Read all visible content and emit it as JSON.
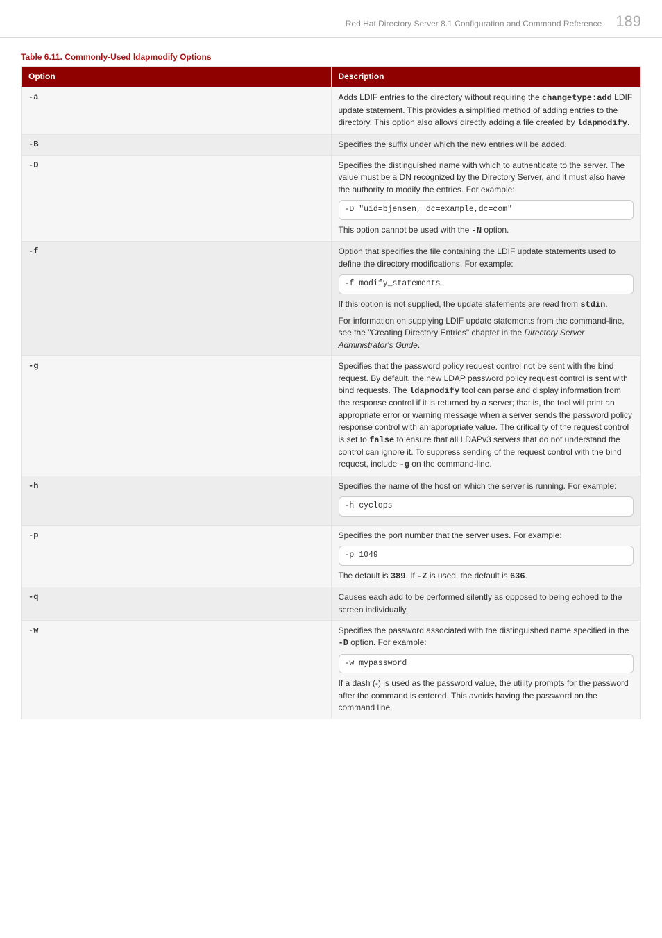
{
  "header": {
    "doc_title": "Red Hat Directory Server 8.1 Configuration and Command Reference",
    "page_number": "189"
  },
  "table_caption": "Table 6.11. Commonly-Used ldapmodify Options",
  "columns": {
    "option": "Option",
    "description": "Description"
  },
  "rows": {
    "a": {
      "opt": "-a",
      "p1a": "Adds LDIF entries to the directory without requiring the ",
      "p1_code1": "changetype:add",
      "p1b": " LDIF update statement. This provides a simplified method of adding entries to the directory. This option also allows directly adding a file created by ",
      "p1_code2": "ldapmodify",
      "p1c": "."
    },
    "B": {
      "opt": "-B",
      "p1": "Specifies the suffix under which the new entries will be added."
    },
    "D": {
      "opt": "-D",
      "p1": "Specifies the distinguished name with which to authenticate to the server. The value must be a DN recognized by the Directory Server, and it must also have the authority to modify the entries. For example:",
      "code": "-D \"uid=bjensen, dc=example,dc=com\"",
      "p2a": "This option cannot be used with the ",
      "p2_code": "-N",
      "p2b": " option."
    },
    "f": {
      "opt": "-f",
      "p1": "Option that specifies the file containing the LDIF update statements used to define the directory modifications. For example:",
      "code": "-f modify_statements",
      "p2a": "If this option is not supplied, the update statements are read from ",
      "p2_code": "stdin",
      "p2b": ".",
      "p3a": "For information on supplying LDIF update statements from the command-line, see the \"Creating Directory Entries\" chapter in the ",
      "p3_italic": "Directory Server Administrator's Guide",
      "p3b": "."
    },
    "g": {
      "opt": "-g",
      "p1a": "Specifies that the password policy request control not be sent with the bind request. By default, the new LDAP password policy request control is sent with bind requests. The ",
      "p1_code1": "ldapmodify",
      "p1b": " tool can parse and display information from the response control if it is returned by a server; that is, the tool will print an appropriate error or warning message when a server sends the password policy response control with an appropriate value. The criticality of the request control is set to ",
      "p1_code2": "false",
      "p1c": " to ensure that all LDAPv3 servers that do not understand the control can ignore it. To suppress sending of the request control with the bind request, include ",
      "p1_code3": "-g",
      "p1d": " on the command-line."
    },
    "h": {
      "opt": "-h",
      "p1": "Specifies the name of the host on which the server is running. For example:",
      "code": "-h cyclops"
    },
    "p": {
      "opt": "-p",
      "p1": "Specifies the port number that the server uses. For example:",
      "code": "-p 1049",
      "p2a": "The default is ",
      "p2_code1": "389",
      "p2b": ". If ",
      "p2_code2": "-Z",
      "p2c": " is used, the default is ",
      "p2_code3": "636",
      "p2d": "."
    },
    "q": {
      "opt": "-q",
      "p1": "Causes each add to be performed silently as opposed to being echoed to the screen individually."
    },
    "w": {
      "opt": "-w",
      "p1a": "Specifies the password associated with the distinguished name specified in the ",
      "p1_code": "-D",
      "p1b": " option. For example:",
      "code": "-w mypassword",
      "p2": "If a dash (-) is used as the password value, the utility prompts for the password after the command is entered. This avoids having the password on the command line."
    }
  }
}
